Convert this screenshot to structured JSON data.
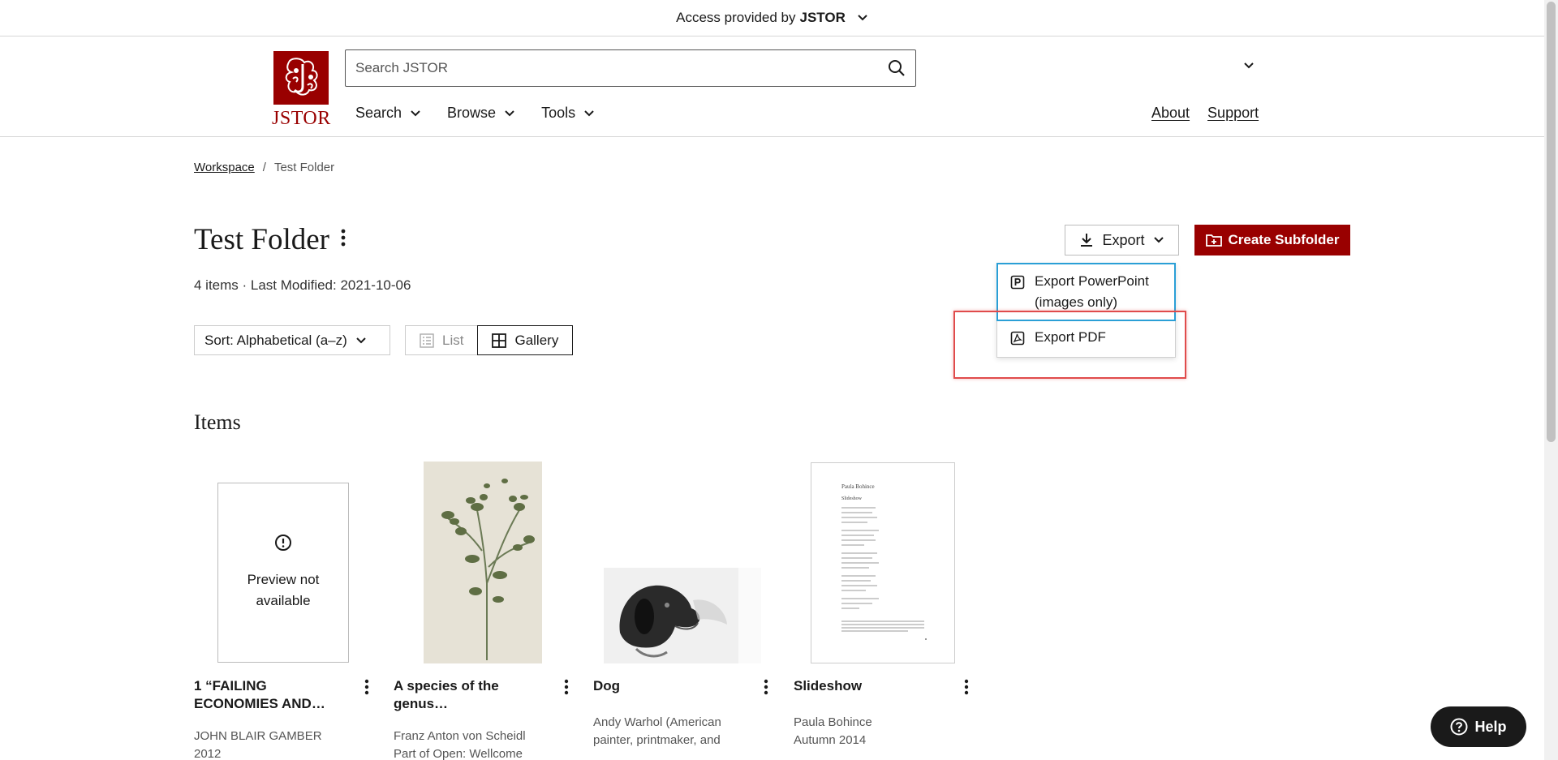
{
  "access_bar": {
    "prefix": "Access provided by",
    "brand": "JSTOR"
  },
  "header": {
    "logo_text": "JSTOR",
    "search_placeholder": "Search JSTOR",
    "nav": [
      {
        "label": "Search"
      },
      {
        "label": "Browse"
      },
      {
        "label": "Tools"
      }
    ],
    "nav_right": [
      {
        "label": "About"
      },
      {
        "label": "Support"
      }
    ]
  },
  "breadcrumb": {
    "parent": "Workspace",
    "separator": "/",
    "current": "Test Folder"
  },
  "folder": {
    "title": "Test Folder",
    "meta": "4 items · Last Modified: 2021-10-06"
  },
  "actions": {
    "export_label": "Export",
    "create_label": "Create Subfolder",
    "export_menu": [
      {
        "label_line1": "Export PowerPoint",
        "label_line2": "(images only)",
        "icon": "powerpoint-icon"
      },
      {
        "label_line1": "Export PDF",
        "icon": "pdf-icon"
      }
    ]
  },
  "controls": {
    "sort_label": "Sort: Alphabetical (a–z)",
    "view_list": "List",
    "view_gallery": "Gallery",
    "active_view": "Gallery"
  },
  "items_heading": "Items",
  "items": [
    {
      "title": "1 “FAILING ECONOMIES AND…",
      "author": "JOHN BLAIR GAMBER",
      "date": "2012",
      "preview": "Preview not available"
    },
    {
      "title": "A species of the genus…",
      "author": "Franz Anton von Scheidl",
      "date": "Part of Open: Wellcome"
    },
    {
      "title": "Dog",
      "author": "Andy Warhol (American painter, printmaker, and"
    },
    {
      "title": "Slideshow",
      "author": "Paula Bohince",
      "date": "Autumn 2014"
    }
  ],
  "slideshow_thumb": {
    "heading": "Paula Bohince",
    "sub": "Slideshow"
  },
  "help_label": "Help",
  "colors": {
    "brand_red": "#990000",
    "highlight_blue": "#2a9fd6",
    "highlight_red": "#e04b4b"
  }
}
